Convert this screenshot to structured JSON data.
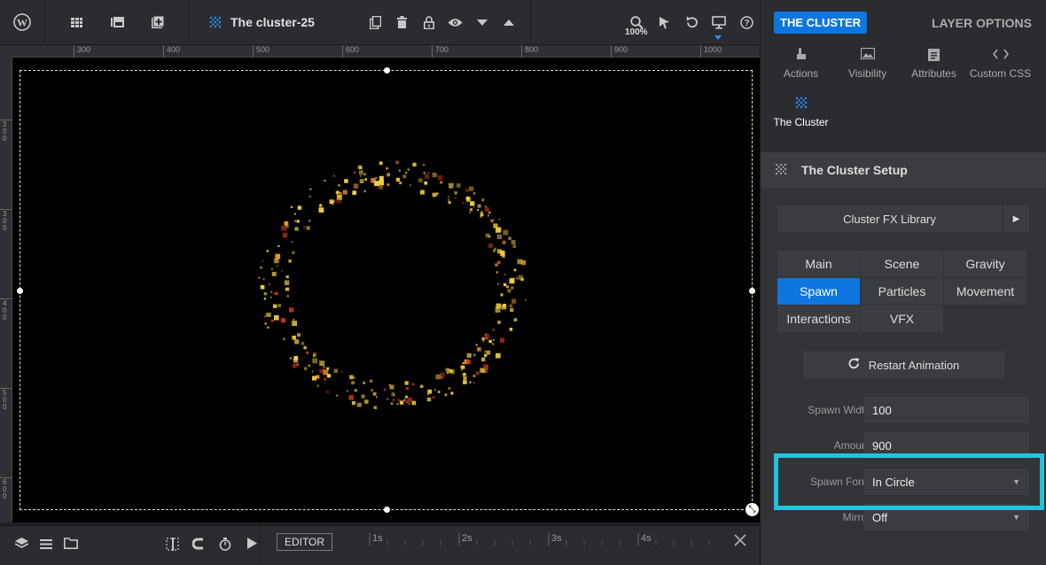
{
  "toolbar": {
    "title": "The cluster-25",
    "zoom": "100%",
    "icons": [
      "wordpress-icon",
      "grid-icon",
      "media-icon",
      "add-icon",
      "cluster-icon",
      "copy-icon",
      "trash-icon",
      "lock-icon",
      "eye-icon",
      "arrow-down-icon",
      "arrow-up-icon",
      "zoom-icon",
      "pointer-icon",
      "undo-icon",
      "monitor-icon",
      "help-icon"
    ]
  },
  "ruler": {
    "top_marks": [
      "300",
      "400",
      "500",
      "600",
      "700",
      "800",
      "900",
      "1000"
    ],
    "left_marks": [
      "200",
      "300",
      "400",
      "500",
      "600"
    ]
  },
  "bottom": {
    "editor_label": "EDITOR",
    "timeline_marks": [
      "1s",
      "2s",
      "3s",
      "4s"
    ]
  },
  "panel": {
    "tab_active": "THE CLUSTER",
    "tab_inactive": "LAYER OPTIONS",
    "addons": [
      {
        "label": "Actions"
      },
      {
        "label": "Visibility"
      },
      {
        "label": "Attributes"
      },
      {
        "label": "Custom CSS"
      },
      {
        "label": "The Cluster"
      }
    ],
    "section_title": "The Cluster Setup",
    "library_label": "Cluster FX Library",
    "subtabs": [
      "Main",
      "Scene",
      "Gravity",
      "Spawn",
      "Particles",
      "Movement",
      "Interactions",
      "VFX"
    ],
    "active_subtab": "Spawn",
    "restart_label": "Restart Animation",
    "fields": {
      "spawn_width": {
        "label": "Spawn Width",
        "value": "100"
      },
      "amount": {
        "label": "Amount",
        "value": "900"
      },
      "spawn_form": {
        "label": "Spawn Form",
        "value": "In Circle"
      },
      "mirror": {
        "label": "Mirror",
        "value": "Off"
      }
    }
  },
  "colors": {
    "accent": "#0e76de",
    "highlight": "#22c3dd",
    "particle_gold": "#f5d040",
    "particle_red": "#d03a20"
  }
}
